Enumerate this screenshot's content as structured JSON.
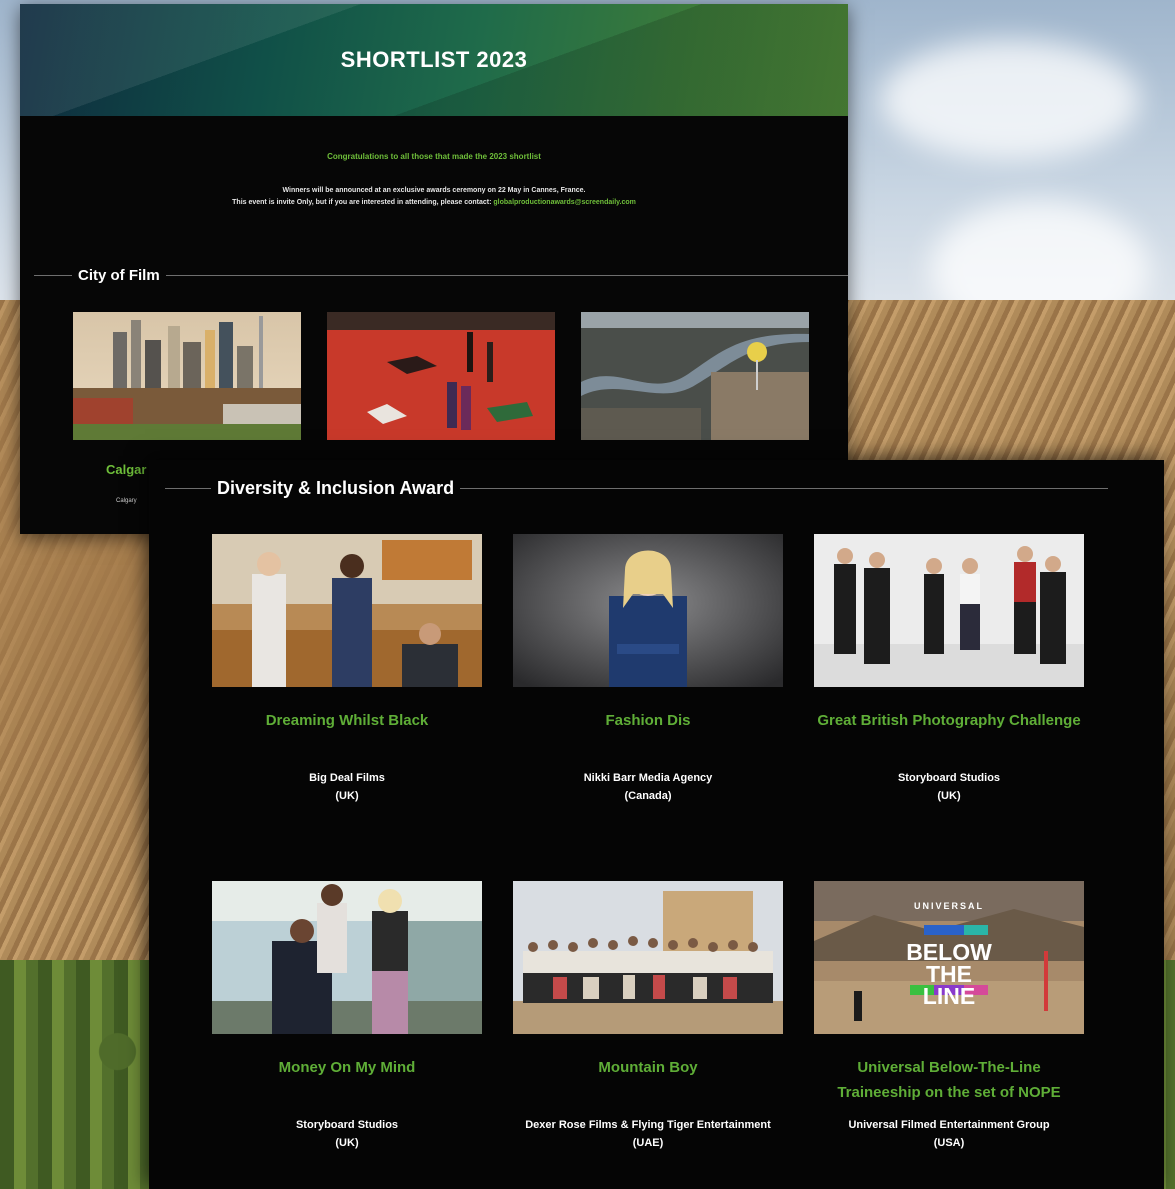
{
  "back_panel": {
    "banner_title": "SHORTLIST 2023",
    "congrats": "Congratulations to all those that made the 2023 shortlist",
    "note_line1": "Winners will be announced at an exclusive awards ceremony on 22 May in Cannes, France.",
    "note_line2_prefix": "This event is invite Only, but if you are interested in attending, please contact:",
    "note_email": "globalproductionawards@screendaily.com",
    "section_title": "City of Film",
    "partial_caption": "Calgar",
    "partial_sub": "Calgary"
  },
  "front_panel": {
    "section_title": "Diversity & Inclusion Award",
    "entries": [
      {
        "name": "Dreaming Whilst Black",
        "company": "Big Deal Films",
        "country": "(UK)"
      },
      {
        "name": "Fashion Dis",
        "company": "Nikki Barr Media Agency",
        "country": "(Canada)"
      },
      {
        "name": "Great British Photography Challenge",
        "company": "Storyboard Studios",
        "country": "(UK)"
      },
      {
        "name": "Money On My Mind",
        "company": "Storyboard Studios",
        "country": "(UK)"
      },
      {
        "name": "Mountain Boy",
        "company": "Dexer Rose Films & Flying Tiger Entertainment",
        "country": "(UAE)"
      },
      {
        "name": "Universal Below-The-Line Traineeship on the set of NOPE",
        "company": "Universal Filmed Entertainment Group",
        "country": "(USA)"
      }
    ],
    "photo_text": {
      "brand": "UNIVERSAL",
      "headline": "BELOW THE LINE"
    }
  },
  "colors": {
    "accent_green": "#5fae37",
    "panel_bg": "#050505",
    "text": "#ffffff"
  }
}
